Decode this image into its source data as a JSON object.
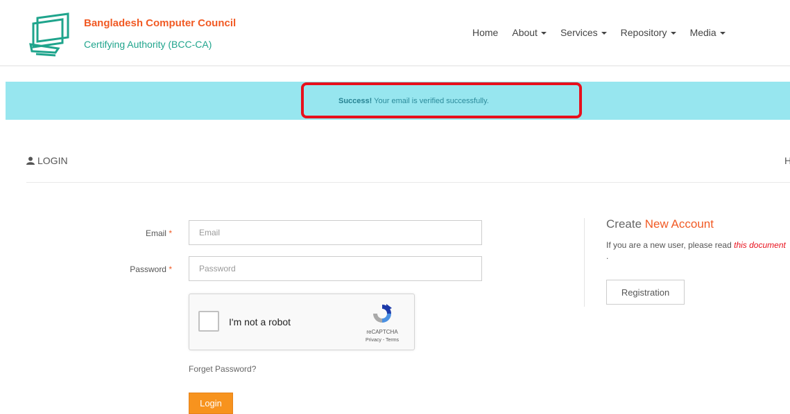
{
  "brand": {
    "title": "Bangladesh Computer Council",
    "subtitle": "Certifying Authority (BCC-CA)"
  },
  "nav": {
    "home": "Home",
    "about": "About",
    "services": "Services",
    "repository": "Repository",
    "media": "Media"
  },
  "alert": {
    "strong": "Success!",
    "message": " Your email is verified successfully."
  },
  "login": {
    "heading": "LOGIN",
    "right_heading_fragment": "H",
    "email_label": "Email",
    "email_placeholder": "Email",
    "password_label": "Password",
    "password_placeholder": "Password",
    "required_mark": "*",
    "forget_password": "Forget Password?",
    "login_button": "Login"
  },
  "captcha": {
    "label": "I'm not a robot",
    "brand": "reCAPTCHA",
    "links": "Privacy - Terms"
  },
  "create_account": {
    "title_prefix": "Create ",
    "title_accent": "New Account",
    "info_prefix": "If you are a new user, please read ",
    "info_link": "this document",
    "info_suffix": " .",
    "registration_button": "Registration"
  },
  "colors": {
    "brand_orange": "#f15a24",
    "brand_green": "#1fa48c",
    "alert_bg": "#97e6ef",
    "highlight_red": "#e8101c",
    "login_button": "#f7931e"
  }
}
